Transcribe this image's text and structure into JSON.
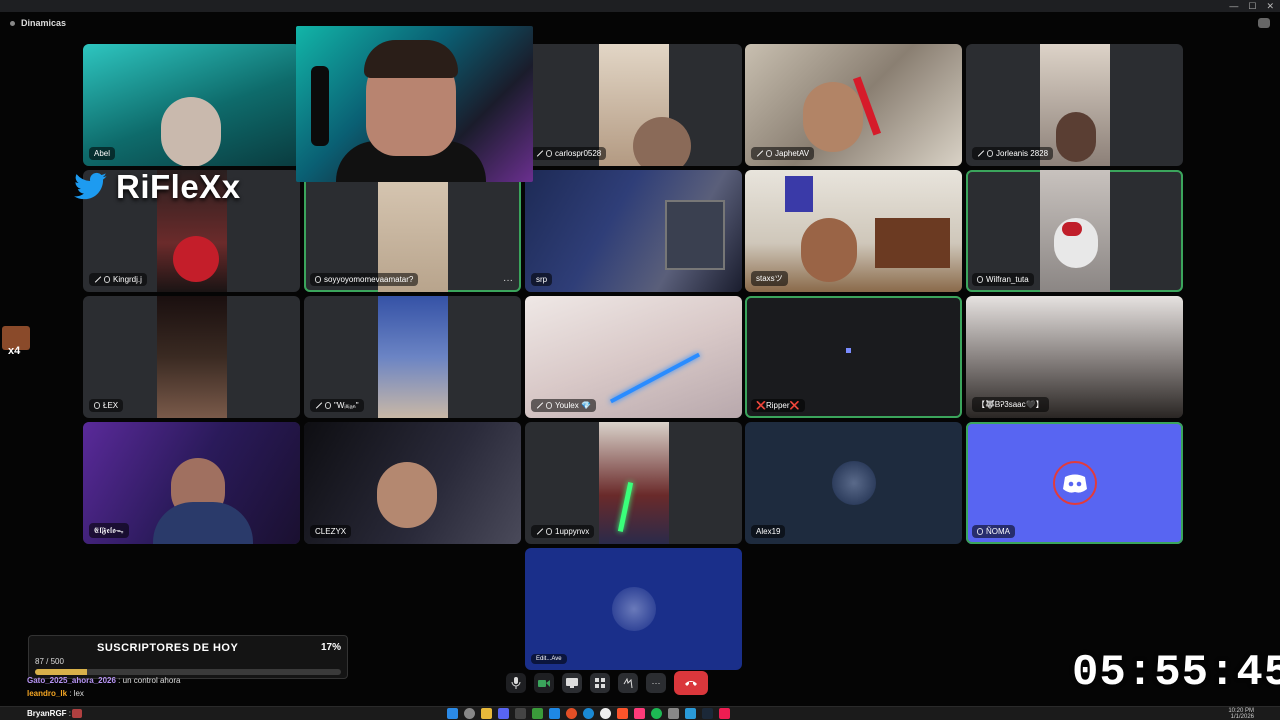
{
  "window": {
    "channel": "Dinamicas",
    "controls": [
      "—",
      "☐",
      "✕"
    ]
  },
  "streamer": {
    "brand_name": "RiFleXx",
    "brand_icon": "twitter-bird-icon",
    "viewer_badge": "x4"
  },
  "participants": [
    {
      "name": "Abel",
      "icons": []
    },
    {
      "name": "carlospr0528",
      "icons": [
        "muted",
        "mobile"
      ]
    },
    {
      "name": "JaphetAV",
      "icons": [
        "muted",
        "mobile"
      ]
    },
    {
      "name": "Jorleanis 2828",
      "icons": [
        "muted",
        "mobile"
      ]
    },
    {
      "name": "Kingrdj.j",
      "icons": [
        "muted",
        "mobile"
      ]
    },
    {
      "name": "soyyoyomomevaamatar?",
      "icons": [
        "mobile"
      ],
      "speaking": true,
      "more": "···"
    },
    {
      "name": "srp",
      "icons": []
    },
    {
      "name": "staxsツ",
      "icons": []
    },
    {
      "name": "Wilfran_tuta",
      "icons": [
        "mobile"
      ],
      "speaking": true
    },
    {
      "name": "ŁEX",
      "icons": [
        "mobile"
      ]
    },
    {
      "name": "\"Wᵢₗₗᵢₐₙ\"",
      "icons": [
        "muted",
        "mobile"
      ]
    },
    {
      "name": "Youlex 💎",
      "icons": [
        "muted",
        "mobile"
      ]
    },
    {
      "name": "❌Ripper❌",
      "icons": [],
      "speaking": true
    },
    {
      "name": "【🐺ᏴᎮ3saac🖤】",
      "icons": []
    },
    {
      "name": "𝕰𝖑𝕱𝖊𝖑𝖔ᯓ",
      "icons": []
    },
    {
      "name": "CLEZYX",
      "icons": []
    },
    {
      "name": "1uppynvx",
      "icons": [
        "muted",
        "mobile"
      ]
    },
    {
      "name": "Alex19",
      "icons": []
    },
    {
      "name": "ÑOMA",
      "icons": [
        "mobile"
      ],
      "speaking": true
    },
    {
      "name": "Edit...Ave",
      "icons": []
    }
  ],
  "sub_goal": {
    "title": "SUSCRIPTORES DE HOY",
    "count_text": "87 / 500",
    "percent_text": "17%",
    "progress": 0.17,
    "bar_color": "#d8b14a"
  },
  "chat": [
    {
      "user": "Gato_2025_ahora_2026",
      "user_color": "#b794f4",
      "text": " : un control ahora"
    },
    {
      "user": "leandro_lk",
      "user_color": "#f5a623",
      "text": " : lex"
    }
  ],
  "chat_bottom": {
    "user": "BryanRGF",
    "text": " :"
  },
  "call_controls": {
    "mic": "microphone-icon",
    "camera": "camera-icon",
    "screen": "screen-share-icon",
    "activities": "activities-icon",
    "soundboard": "soundboard-icon",
    "more": "···",
    "hangup": "hang-up-icon",
    "accent": "#da373c",
    "video_color": "#3ba55c"
  },
  "timer": "05:55:45",
  "taskbar": {
    "time": "10:20 PM",
    "date": "1/1/2026"
  }
}
